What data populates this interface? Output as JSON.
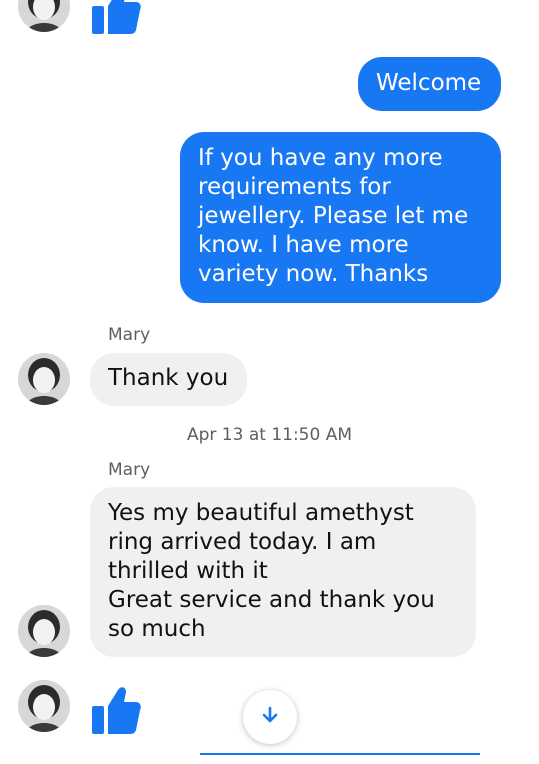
{
  "colors": {
    "accent": "#1877f2",
    "incoming_bubble": "#f0f0f3",
    "meta_text": "#5e5e63"
  },
  "messages": {
    "outgoing_1": "Welcome",
    "outgoing_2": [
      "If you have any more",
      "requirements for",
      "jewellery. Please let me",
      "know. I have more",
      "variety now. Thanks"
    ],
    "sender_1": "Mary",
    "incoming_1": "Thank you",
    "timestamp": "Apr 13 at 11:50 AM",
    "sender_2": "Mary",
    "incoming_2": [
      "Yes my beautiful amethyst",
      "ring arrived today. I am",
      "thrilled with it",
      "Great service and thank you",
      "so much"
    ]
  },
  "icons": {
    "like": "thumbs-up-icon",
    "scroll_down": "arrow-down-icon",
    "avatar": "avatar"
  }
}
